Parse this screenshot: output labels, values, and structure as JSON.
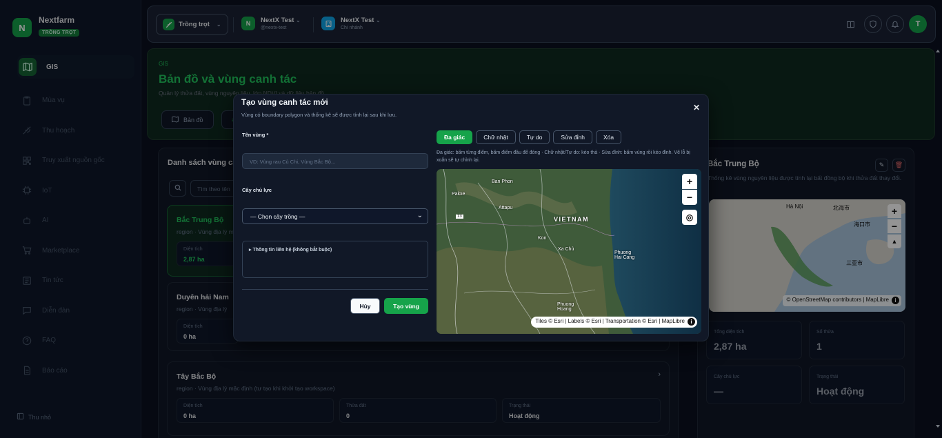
{
  "brand": {
    "name": "Nextfarm",
    "badge": "TRỒNG TRỌT",
    "logo_letter": "N"
  },
  "sidebar": {
    "items": [
      {
        "label": "GIS",
        "icon": "map-icon",
        "active": true
      },
      {
        "label": "Mùa vụ",
        "icon": "clipboard-icon"
      },
      {
        "label": "Thu hoạch",
        "icon": "sprout-icon"
      },
      {
        "label": "Truy xuất nguồn gốc",
        "icon": "qr-code-icon"
      },
      {
        "label": "IoT",
        "icon": "chip-icon"
      },
      {
        "label": "AI",
        "icon": "robot-icon"
      },
      {
        "label": "Marketplace",
        "icon": "cart-icon"
      },
      {
        "label": "Tin tức",
        "icon": "newspaper-icon"
      },
      {
        "label": "Diễn đàn",
        "icon": "chat-icon"
      },
      {
        "label": "FAQ",
        "icon": "help-circle-icon"
      },
      {
        "label": "Báo cáo",
        "icon": "report-icon"
      }
    ],
    "collapse_label": "Thu nhỏ"
  },
  "topbar": {
    "crop_selector": "Trồng trọt",
    "workspace": {
      "letter": "N",
      "name": "NextX Test",
      "handle": "@nextx-test"
    },
    "branch": {
      "name": "NextX Test",
      "sub": "Chi nhánh"
    },
    "avatar_letter": "T"
  },
  "hero": {
    "kicker": "GIS",
    "title": "Bản đồ và vùng canh tác",
    "subtitle": "Quản lý thửa đất, vùng nguyên liệu, lớp NDVI và dữ liệu bản đồ.",
    "tabs": [
      "Bản đồ",
      ""
    ]
  },
  "list": {
    "title": "Danh sách vùng ca",
    "search_placeholder": "Tìm theo tên",
    "regions": [
      {
        "name": "Bắc Trung Bộ",
        "desc": "region · Vùng địa lý m",
        "stats": [
          {
            "label": "Diện tích",
            "value": "2,87 ha"
          }
        ]
      },
      {
        "name": "Duyên hải Nam",
        "desc": "region · Vùng địa lý",
        "stats": [
          {
            "label": "Diện tích",
            "value": "0 ha"
          }
        ]
      },
      {
        "name": "Tây Bắc Bộ",
        "desc": "region · Vùng địa lý mặc định (tự tạo khi khởi tạo workspace)",
        "stats": [
          {
            "label": "Diện tích",
            "value": "0 ha"
          },
          {
            "label": "Thửa đất",
            "value": "0"
          },
          {
            "label": "Trạng thái",
            "value": "Hoạt động"
          }
        ]
      }
    ]
  },
  "detail": {
    "title": "Bắc Trung Bộ",
    "desc": "Thống kê vùng nguyên liệu được tính lại bất đồng bộ khi thửa đất thay đổi.",
    "map_labels": {
      "hanoi": "Hà Nội",
      "beibu": "北海市",
      "haikou": "海口市",
      "sanya": "三亚市"
    },
    "map_attribution": "© OpenStreetMap contributors | MapLibre",
    "cards": [
      {
        "label": "Tổng diện tích",
        "value": "2,87 ha"
      },
      {
        "label": "Số thửa",
        "value": "1"
      },
      {
        "label": "Cây chủ lực",
        "value": "—"
      },
      {
        "label": "Trạng thái",
        "value": "Hoạt động"
      }
    ]
  },
  "modal": {
    "title": "Tạo vùng canh tác mới",
    "subtitle": "Vùng có boundary polygon và thống kê sẽ được tính lại sau khi lưu.",
    "name_label": "Tên vùng *",
    "name_placeholder": "VD: Vùng rau Củ Chi, Vùng Bắc Bộ...",
    "crop_label": "Cây chủ lực",
    "crop_selected": "— Chọn cây trồng —",
    "contact_toggle": "Thông tin liên hệ (không bắt buộc)",
    "cancel_label": "Hủy",
    "create_label": "Tạo vùng",
    "tools": [
      "Đa giác",
      "Chữ nhật",
      "Tự do",
      "Sửa đỉnh",
      "Xóa"
    ],
    "hint": "Đa giác: bấm từng điểm, bấm điểm đầu để đóng · Chữ nhật/Tự do: kéo thả · Sửa đỉnh: bấm vùng rồi kéo đỉnh. Vẽ lỗ bị xoắn sẽ tự chỉnh lại.",
    "map_labels": {
      "banphon": "Ban Phon",
      "pakxe": "Pakxe",
      "attapu": "Attapu",
      "vietnam": "VIETNAM",
      "kon": "Kon",
      "quangngai": "Quảng Ngãi",
      "xuanha": "Xa Chủ",
      "phuong": "Phuong\nHai Cang",
      "phuonghoang": "Phuong\nHoang",
      "road": "13"
    },
    "map_attribution": "Tiles © Esri | Labels © Esri | Transportation © Esri | MapLibre"
  },
  "colors": {
    "accent": "#16a34a",
    "accent_text": "#22c55e",
    "background": "#0b1120",
    "panel": "#111827"
  }
}
